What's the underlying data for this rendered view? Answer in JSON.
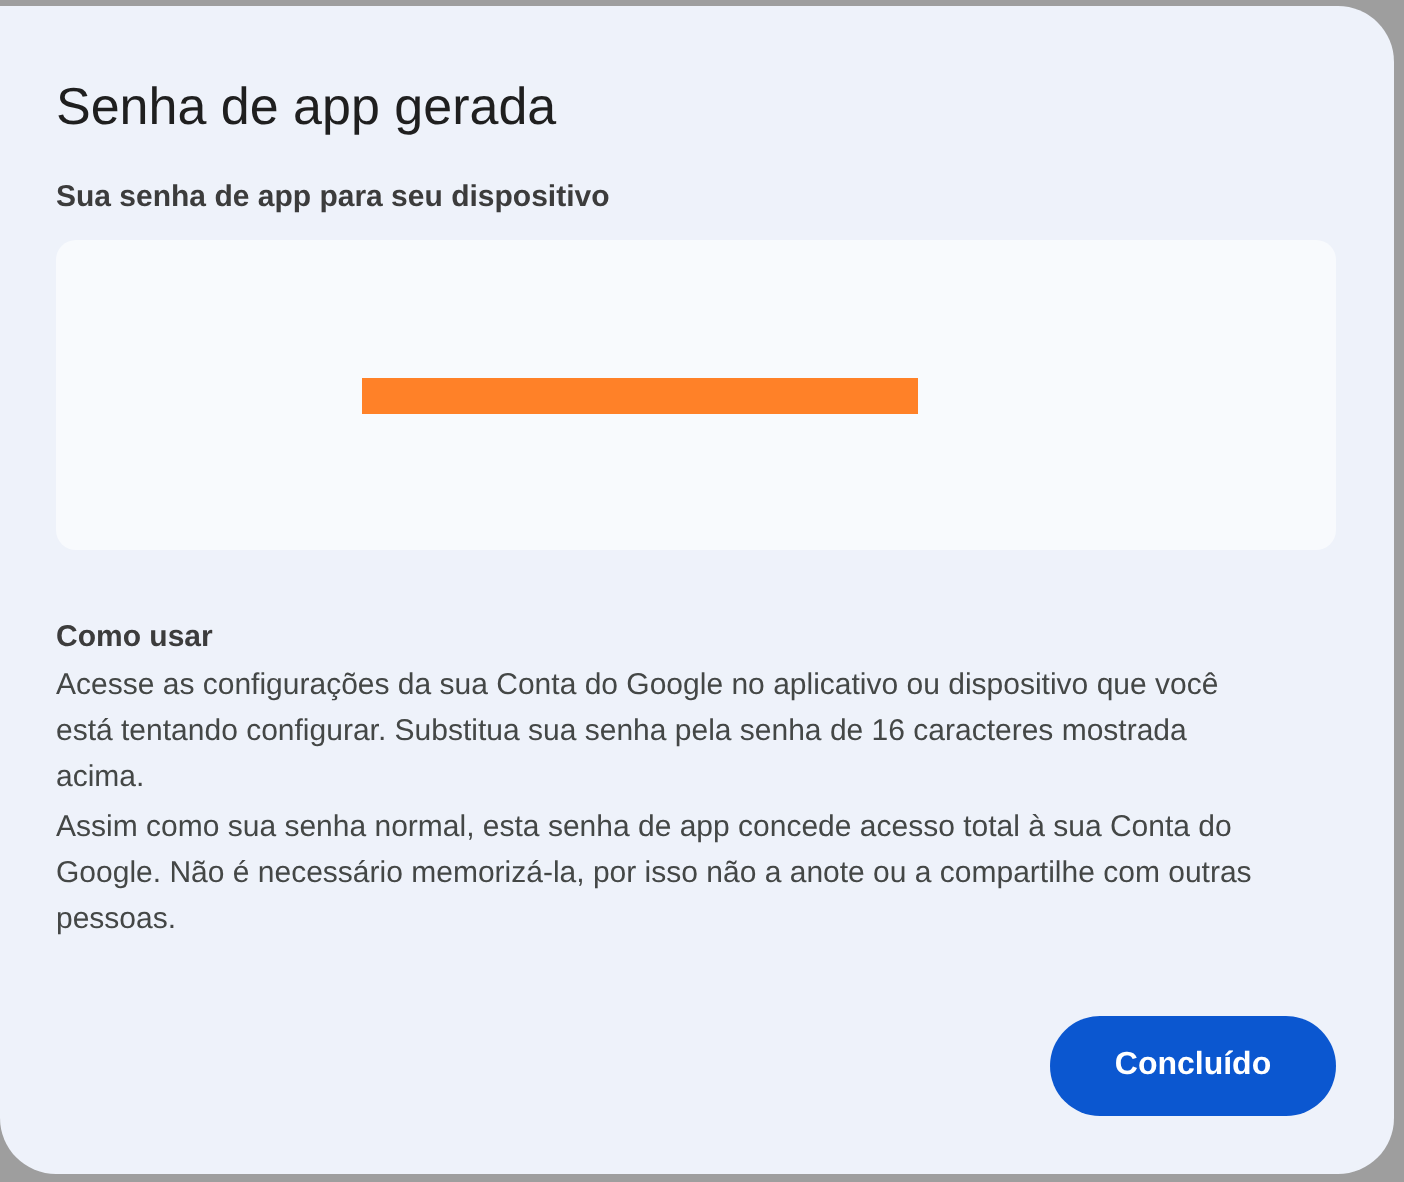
{
  "dialog": {
    "title": "Senha de app gerada",
    "password_label": "Sua senha de app para seu dispositivo",
    "password_redacted": true,
    "how_to": {
      "heading": "Como usar",
      "paragraphs": [
        "Acesse as configurações da sua Conta do Google no aplicativo ou dispositivo que você está tentando configurar. Substitua sua senha pela senha de 16 caracteres mostrada acima.",
        "Assim como sua senha normal, esta senha de app concede acesso total à sua Conta do Google. Não é necessário memorizá-la, por isso não a anote ou a compartilhe com outras pessoas."
      ]
    },
    "buttons": [
      "Concluído"
    ]
  }
}
